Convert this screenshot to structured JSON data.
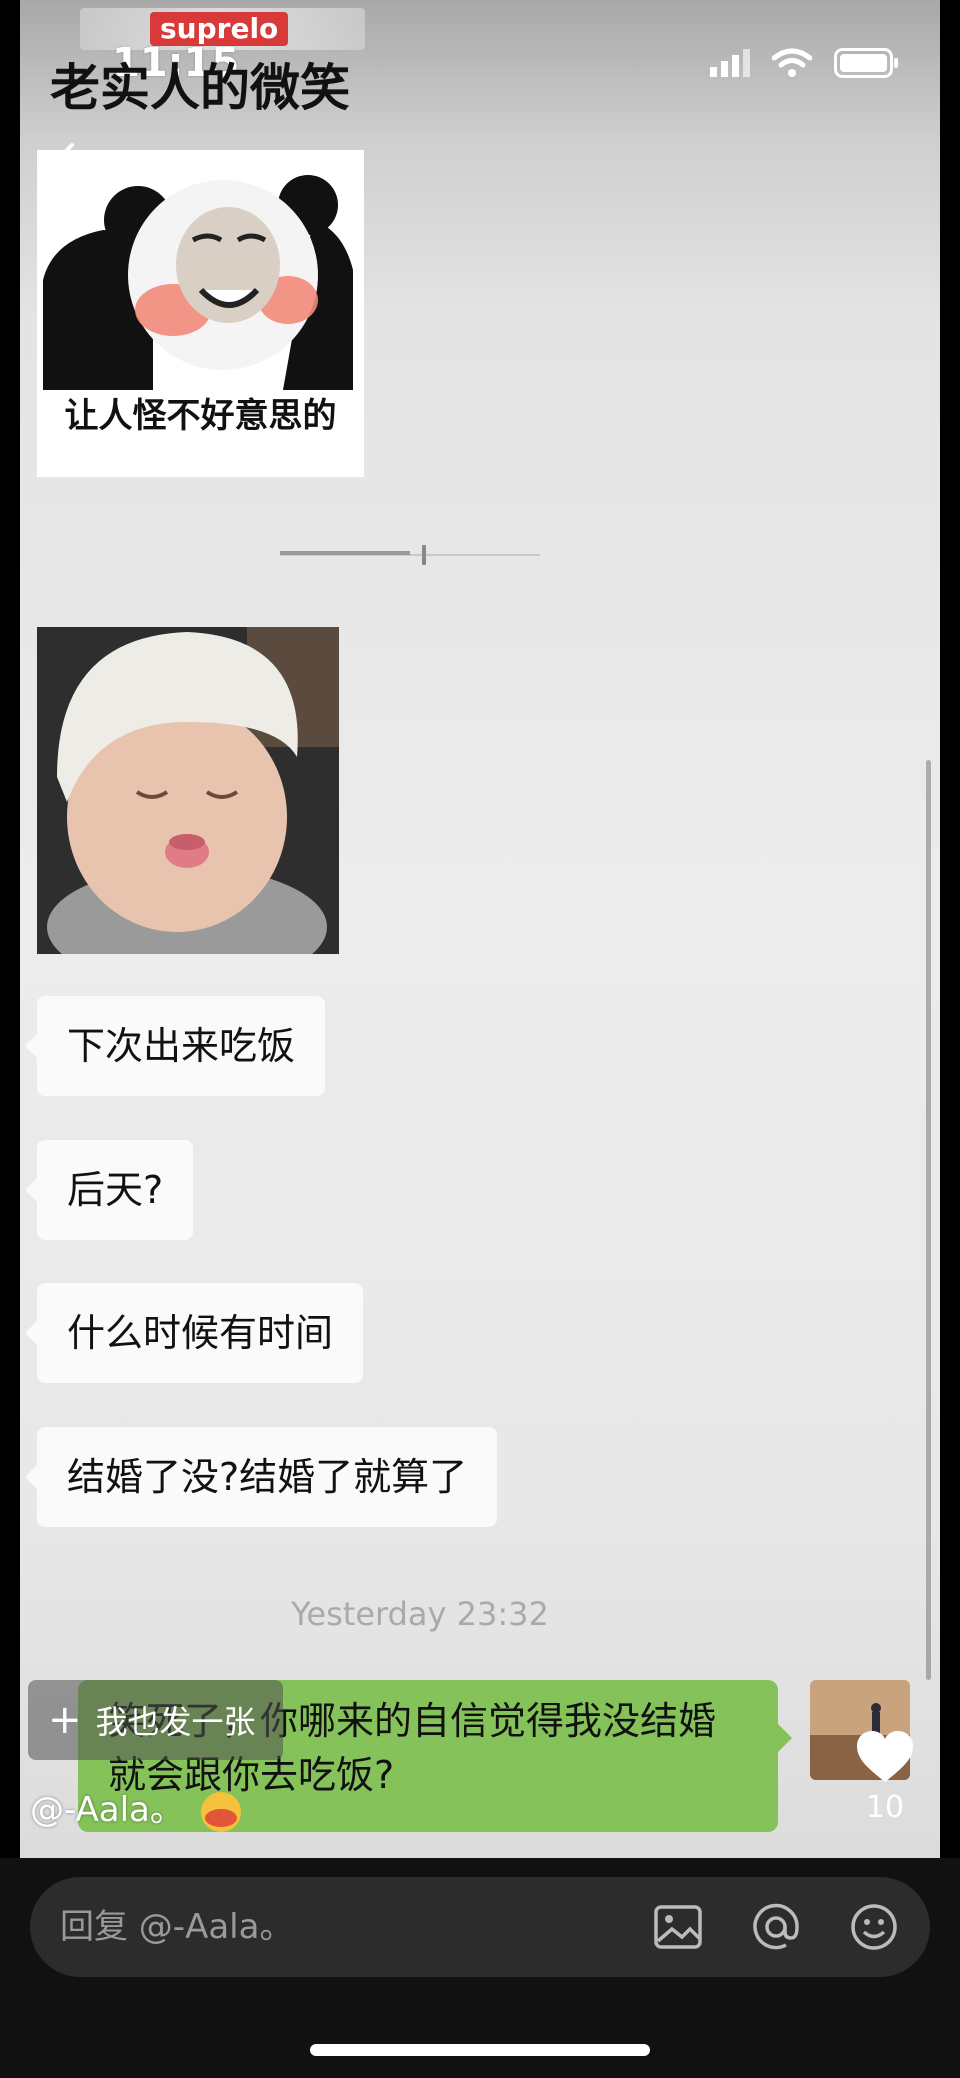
{
  "status_bar": {
    "time": "11:15"
  },
  "header": {
    "brand": "suprelo",
    "post_title": "老实人的微笑"
  },
  "chat": {
    "sticker_caption": "让人怪不好意思的",
    "messages": [
      "下次出来吃饭",
      "后天?",
      "什么时候有时间",
      "结婚了没?结婚了就算了"
    ],
    "timestamp": "Yesterday 23:32",
    "my_message": "笑死了，你哪来的自信觉得我没结婚就会跟你去吃饭?"
  },
  "overlay": {
    "reply_button": "我也发一张",
    "author": "@-Aala。",
    "likes": "10"
  },
  "input": {
    "placeholder": "回复 @-Aala。"
  },
  "colors": {
    "outgoing_bubble": "#85c259",
    "incoming_bubble": "#fafafa",
    "brand": "#d83a3a"
  },
  "icons": [
    "back-icon",
    "signal-icon",
    "wifi-icon",
    "battery-icon",
    "image-icon",
    "at-icon",
    "emoji-icon",
    "heart-icon",
    "plus-icon"
  ]
}
